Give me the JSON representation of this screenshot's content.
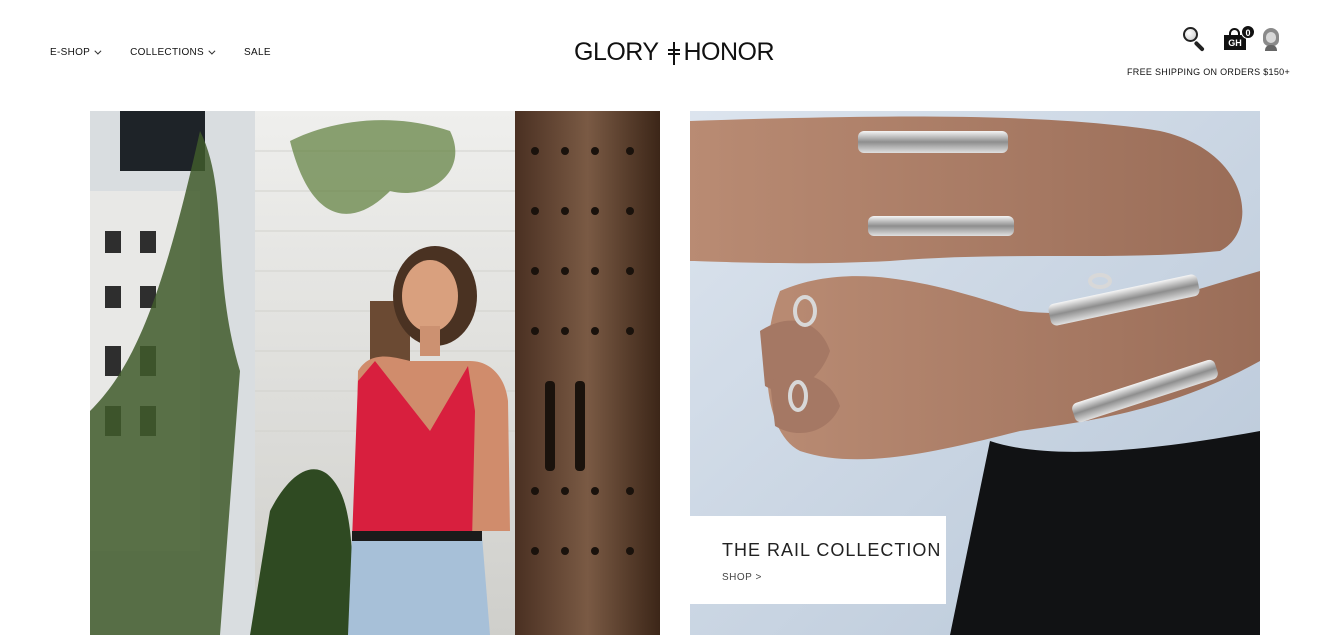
{
  "header": {
    "nav": [
      {
        "label": "E-SHOP",
        "dropdown": true
      },
      {
        "label": "COLLECTIONS",
        "dropdown": true
      },
      {
        "label": "SALE",
        "dropdown": false
      }
    ],
    "logo_left": "GLORY",
    "logo_right": "HONOR",
    "cart_label": "GH",
    "cart_count": "0",
    "shipping_notice": "FREE SHIPPING ON ORDERS $150+"
  },
  "hero": {
    "left_image": "woman-red-top-photo",
    "right_image": "rail-bracelets-photo",
    "promo": {
      "title": "THE RAIL COLLECTION",
      "link": "SHOP >"
    }
  },
  "colors": {
    "text": "#111111",
    "background": "#ffffff"
  },
  "icons": [
    "search-icon",
    "bag-icon",
    "avatar-icon",
    "chevron-down-icon"
  ]
}
